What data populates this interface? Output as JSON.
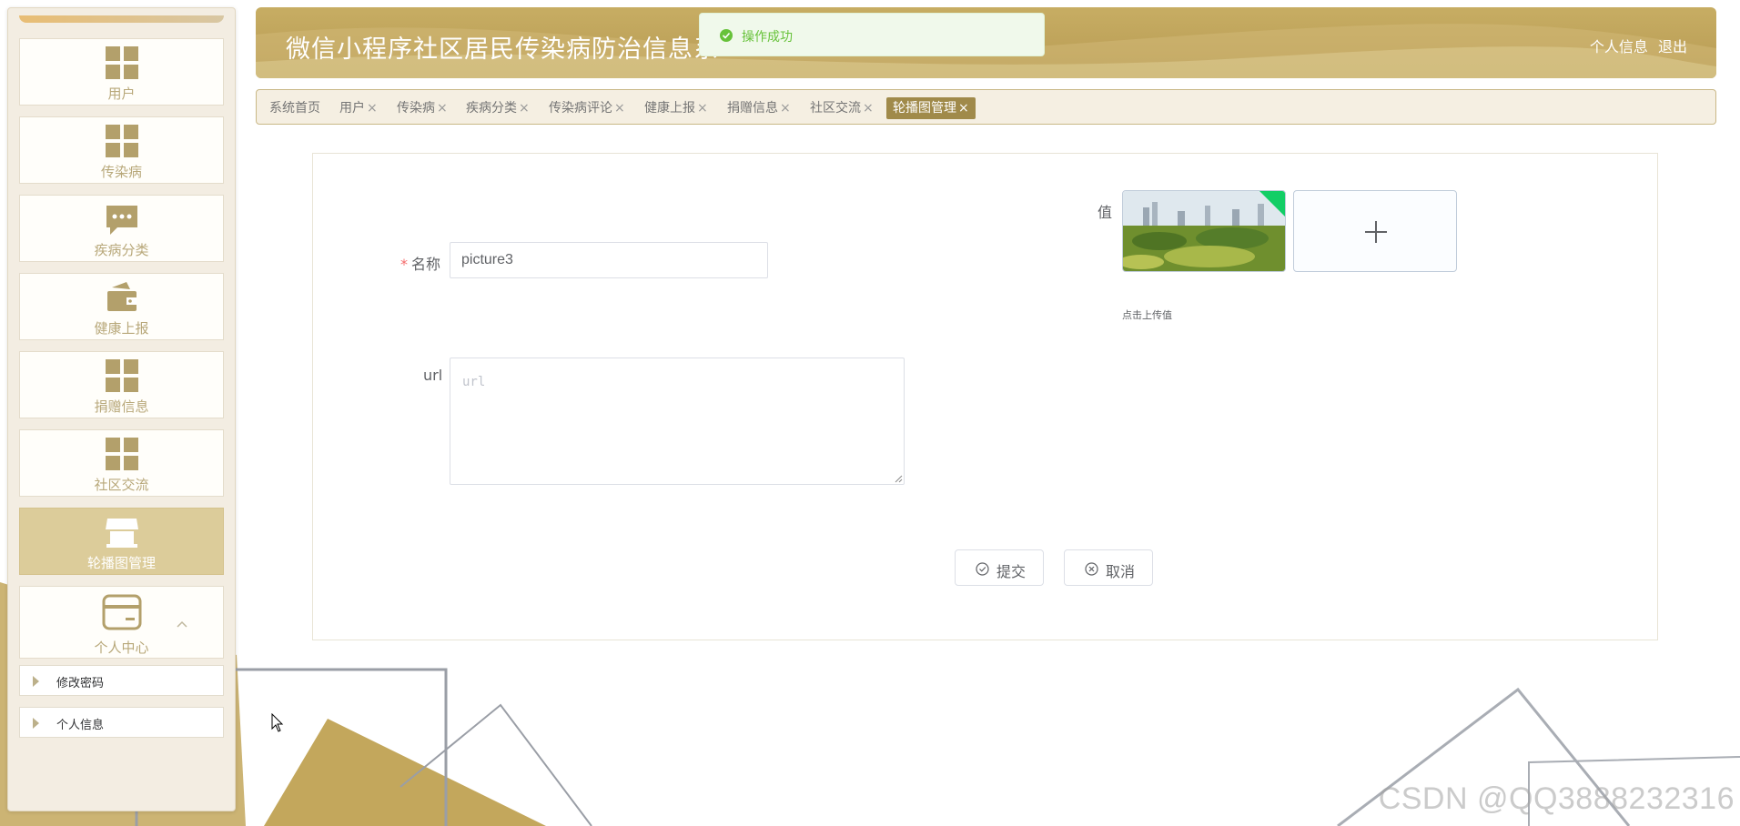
{
  "app": {
    "title": "微信小程序社区居民传染病防治信息系",
    "header_links": [
      "个人信息",
      "退出"
    ]
  },
  "toast": {
    "message": "操作成功",
    "icon": "success-check-icon",
    "color": "#67c23a"
  },
  "sidebar": {
    "items": [
      {
        "label": "用户",
        "icon": "grid-icon"
      },
      {
        "label": "传染病",
        "icon": "grid-icon"
      },
      {
        "label": "疾病分类",
        "icon": "chat-bubble-icon"
      },
      {
        "label": "健康上报",
        "icon": "wallet-icon"
      },
      {
        "label": "捐赠信息",
        "icon": "grid-icon"
      },
      {
        "label": "社区交流",
        "icon": "grid-icon"
      },
      {
        "label": "轮播图管理",
        "icon": "storefront-icon",
        "active": true
      },
      {
        "label": "个人中心",
        "icon": "card-icon",
        "expanded": true
      }
    ],
    "submenu": [
      {
        "label": "修改密码"
      },
      {
        "label": "个人信息"
      }
    ]
  },
  "tabs": [
    {
      "label": "系统首页",
      "closable": false
    },
    {
      "label": "用户",
      "closable": true
    },
    {
      "label": "传染病",
      "closable": true
    },
    {
      "label": "疾病分类",
      "closable": true
    },
    {
      "label": "传染病评论",
      "closable": true
    },
    {
      "label": "健康上报",
      "closable": true
    },
    {
      "label": "捐赠信息",
      "closable": true
    },
    {
      "label": "社区交流",
      "closable": true
    },
    {
      "label": "轮播图管理",
      "closable": true,
      "active": true
    }
  ],
  "close_glyph": "×",
  "form": {
    "name_label": "名称",
    "name_required_mark": "*",
    "name_value": "picture3",
    "value_label": "值",
    "upload_tip": "点击上传值",
    "url_label": "url",
    "url_placeholder": "url",
    "submit_label": "提交",
    "cancel_label": "取消"
  },
  "watermark": "CSDN @QQ3888232316",
  "colors": {
    "accent": "#bca058",
    "active_tab": "#a08a4a",
    "sidebar_icon": "#b8a87a",
    "success": "#67c23a"
  }
}
